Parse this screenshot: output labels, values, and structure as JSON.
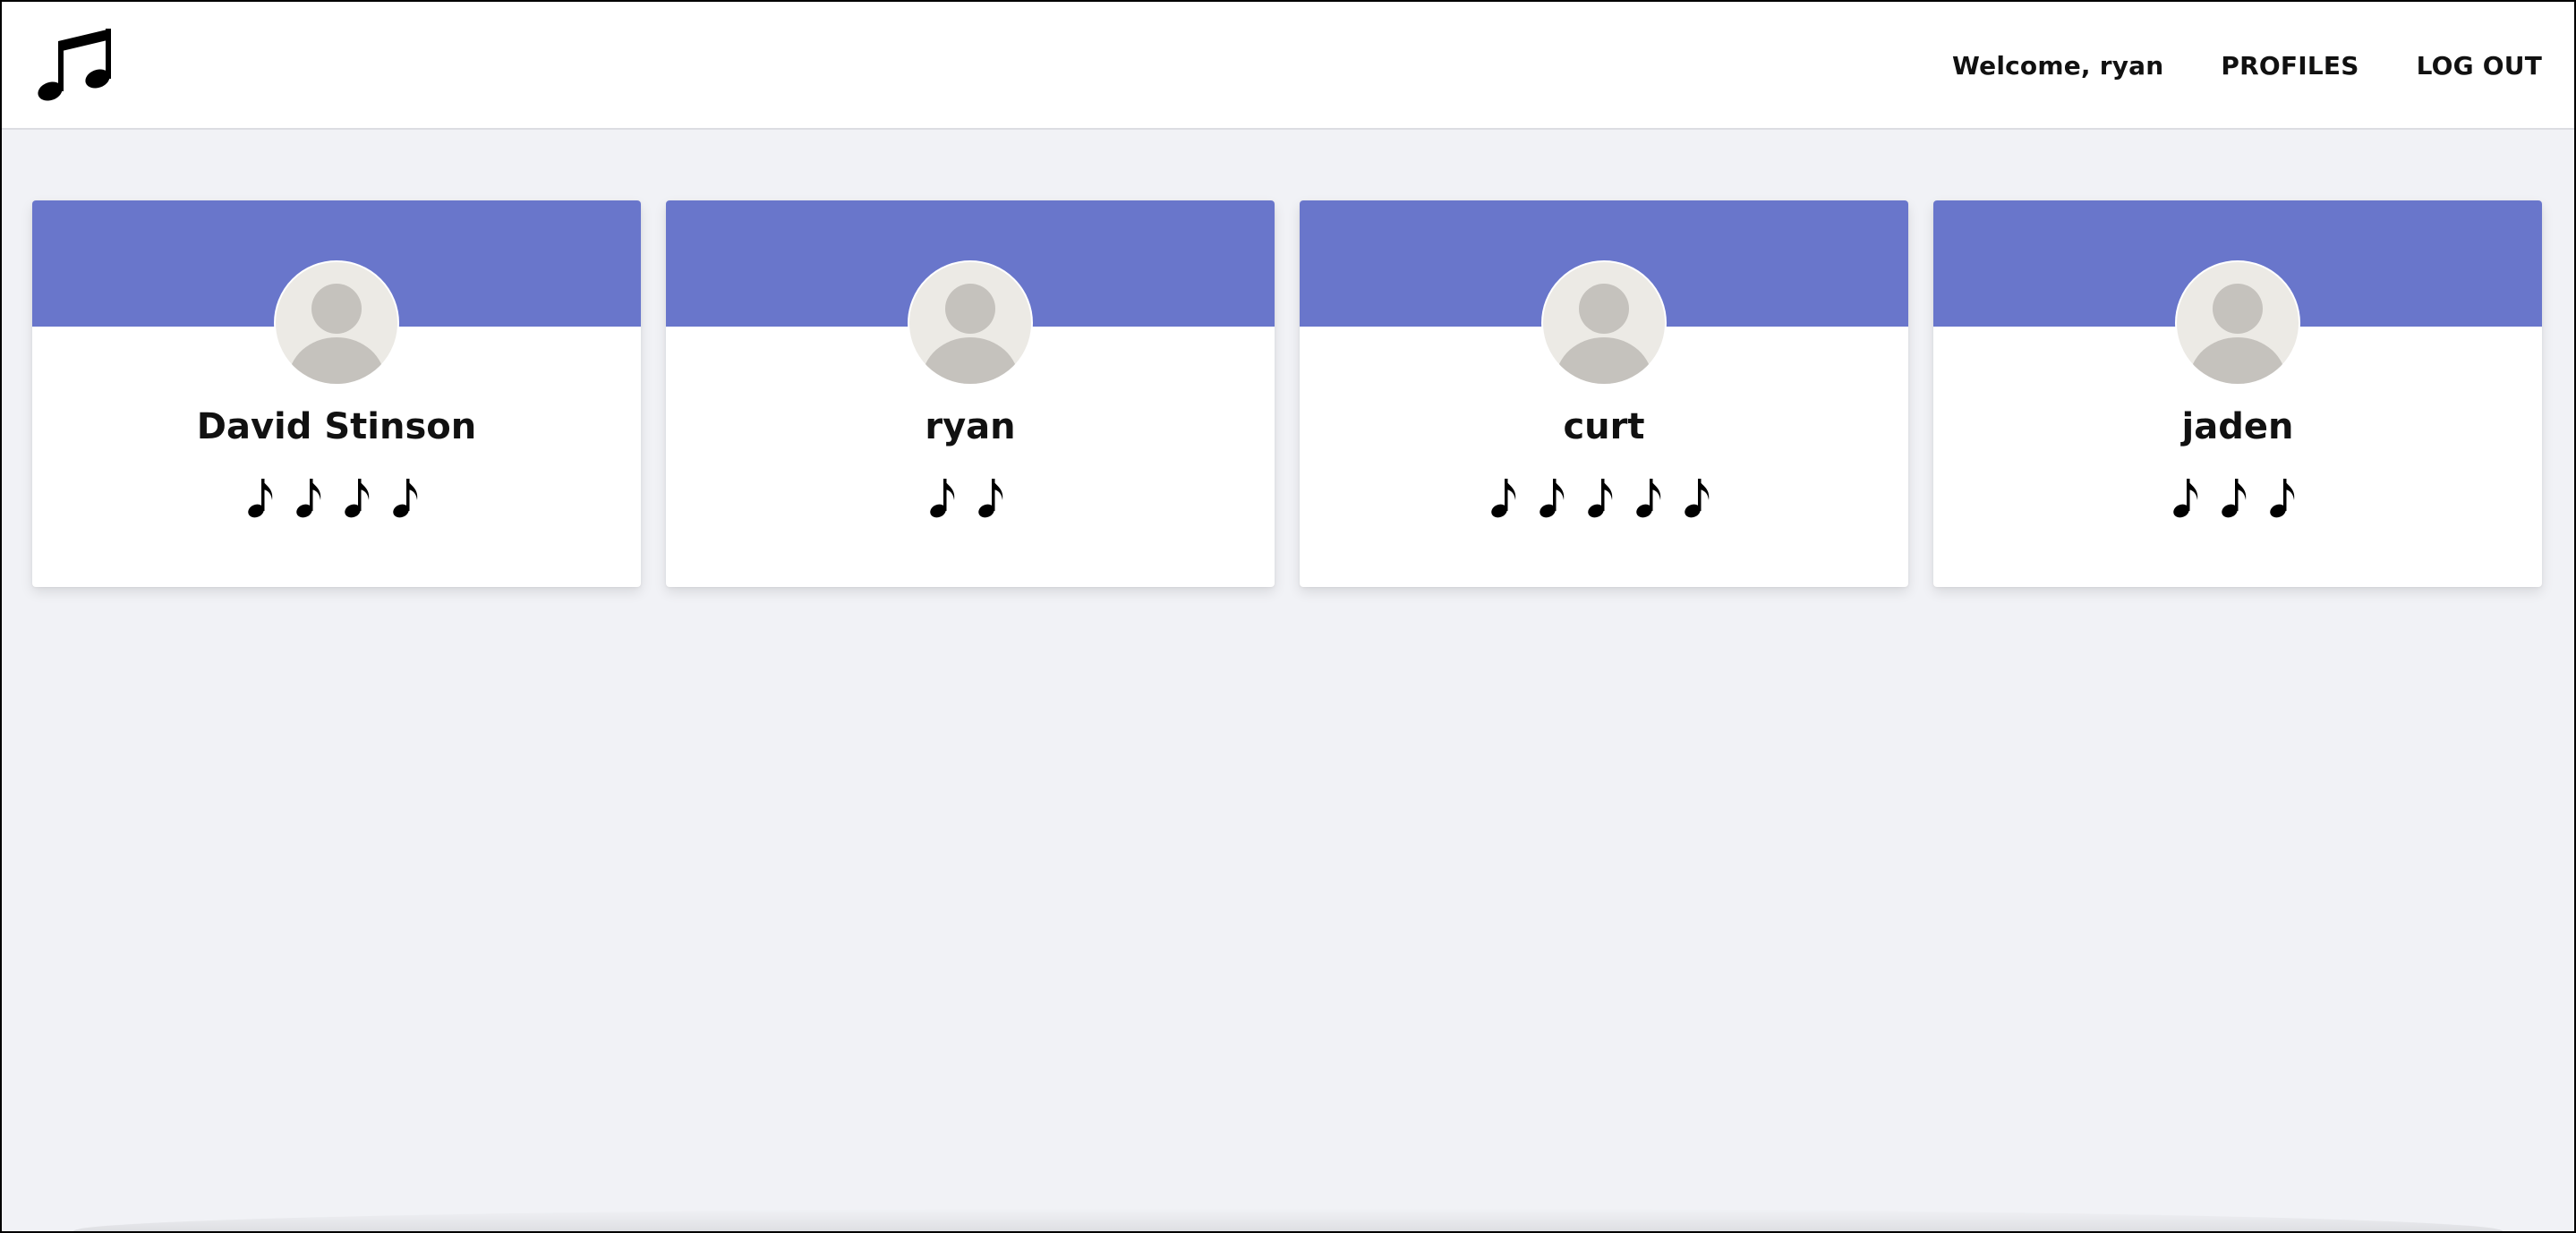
{
  "header": {
    "logo_icon": "music-notes-icon",
    "welcome_text": "Welcome, ryan",
    "profiles_label": "PROFILES",
    "logout_label": "LOG OUT"
  },
  "colors": {
    "banner": "#6976cb",
    "background": "#f1f2f6",
    "card": "#ffffff",
    "avatar_bg": "#eceae5",
    "avatar_fg": "#c5c2bd"
  },
  "profiles": [
    {
      "name": "David Stinson",
      "rating": 4,
      "rating_icon": "eighth-note-icon",
      "avatar_icon": "default-user-avatar-icon"
    },
    {
      "name": "ryan",
      "rating": 2,
      "rating_icon": "eighth-note-icon",
      "avatar_icon": "default-user-avatar-icon"
    },
    {
      "name": "curt",
      "rating": 5,
      "rating_icon": "eighth-note-icon",
      "avatar_icon": "default-user-avatar-icon"
    },
    {
      "name": "jaden",
      "rating": 3,
      "rating_icon": "eighth-note-icon",
      "avatar_icon": "default-user-avatar-icon"
    }
  ]
}
